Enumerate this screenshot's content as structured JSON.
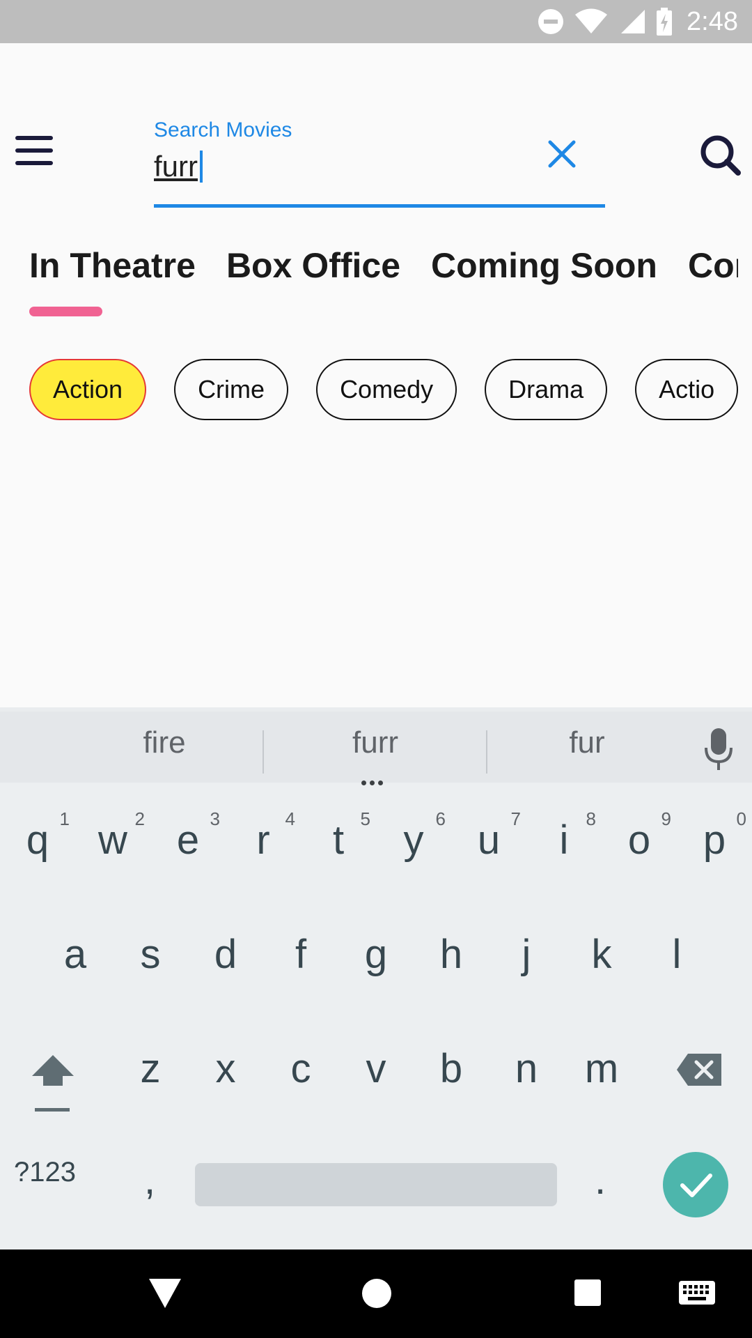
{
  "status_bar": {
    "time": "2:48",
    "icons": [
      "do-not-disturb-icon",
      "wifi-icon",
      "signal-icon",
      "battery-charging-icon"
    ]
  },
  "search": {
    "label": "Search Movies",
    "value": "furr"
  },
  "tabs": [
    {
      "label": "In Theatre",
      "selected": true
    },
    {
      "label": "Box Office",
      "selected": false
    },
    {
      "label": "Coming Soon",
      "selected": false
    },
    {
      "label": "Com",
      "selected": false
    }
  ],
  "chips": [
    {
      "label": "Action",
      "selected": true
    },
    {
      "label": "Crime",
      "selected": false
    },
    {
      "label": "Comedy",
      "selected": false
    },
    {
      "label": "Drama",
      "selected": false
    },
    {
      "label": "Actio",
      "selected": false
    }
  ],
  "keyboard": {
    "suggestions": [
      "fire",
      "furr",
      "fur"
    ],
    "row1": [
      [
        "q",
        "1"
      ],
      [
        "w",
        "2"
      ],
      [
        "e",
        "3"
      ],
      [
        "r",
        "4"
      ],
      [
        "t",
        "5"
      ],
      [
        "y",
        "6"
      ],
      [
        "u",
        "7"
      ],
      [
        "i",
        "8"
      ],
      [
        "o",
        "9"
      ],
      [
        "p",
        "0"
      ]
    ],
    "row2": [
      "a",
      "s",
      "d",
      "f",
      "g",
      "h",
      "j",
      "k",
      "l"
    ],
    "row3": [
      "z",
      "x",
      "c",
      "v",
      "b",
      "n",
      "m"
    ],
    "symbols_label": "?123",
    "comma": ",",
    "period": "."
  },
  "colors": {
    "accent": "#1e88e5",
    "tab_indicator": "#f06292",
    "chip_selected_fill": "#ffeb3b",
    "chip_selected_border": "#e53935",
    "enter_key": "#4db6ac"
  }
}
